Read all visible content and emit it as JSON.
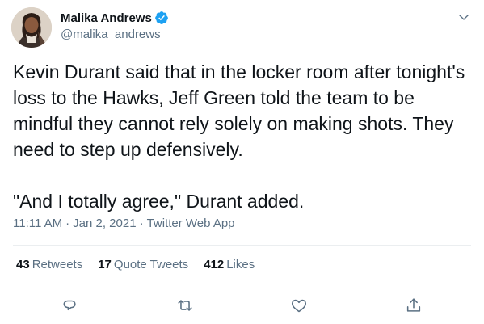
{
  "tweet": {
    "author": {
      "name": "Malika Andrews",
      "handle": "@malika_andrews",
      "verified": true
    },
    "text": [
      "Kevin Durant said that in the locker room after tonight's loss to the Hawks, Jeff Green told the team to be mindful they cannot rely solely on making shots. They need to step up defensively.",
      "\"And I totally agree,\" Durant added."
    ],
    "time": "11:11 AM",
    "date": "Jan 2, 2021",
    "source": "Twitter Web App",
    "separator": "·",
    "stats": {
      "retweets": {
        "count": "43",
        "label": "Retweets"
      },
      "quotes": {
        "count": "17",
        "label": "Quote Tweets"
      },
      "likes": {
        "count": "412",
        "label": "Likes"
      }
    }
  },
  "colors": {
    "text_primary": "#0f1419",
    "text_secondary": "#5b7083",
    "verified_blue": "#1da1f2",
    "divider": "#ebeef0"
  }
}
